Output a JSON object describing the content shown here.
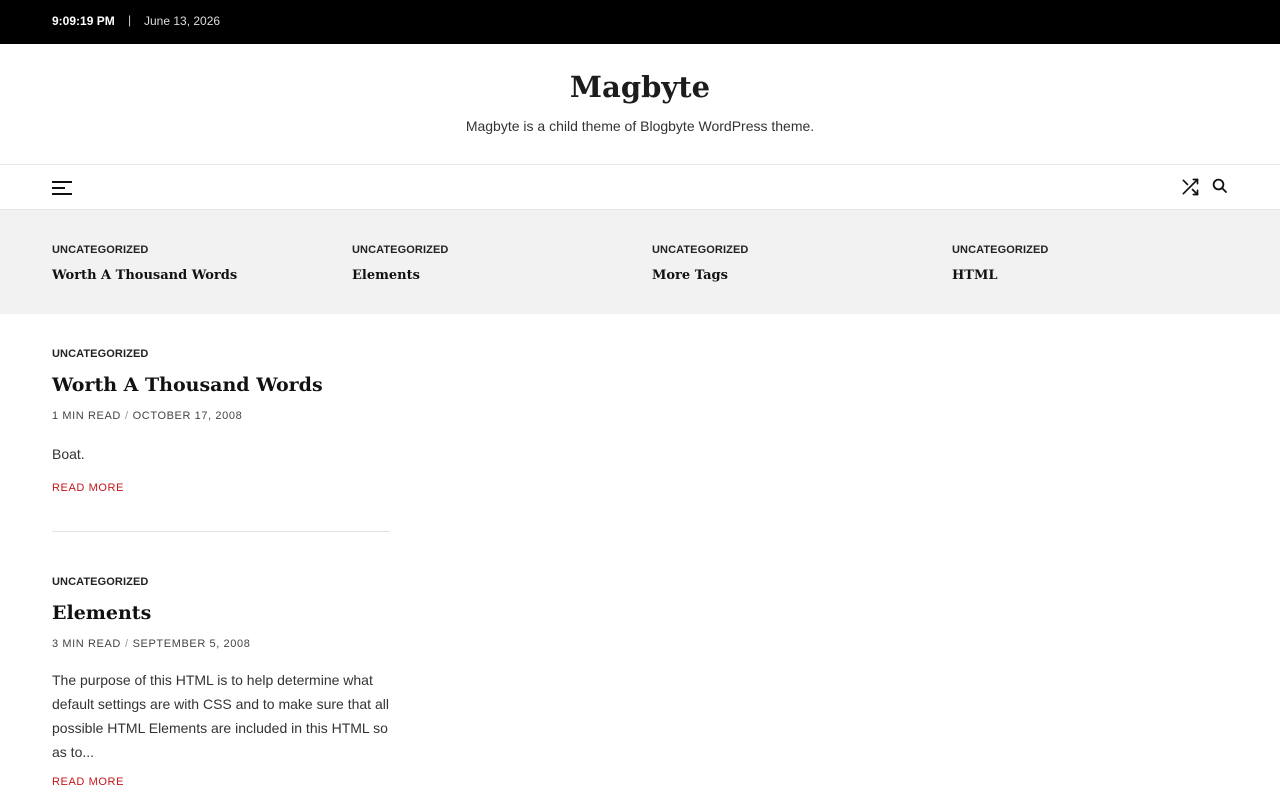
{
  "topbar": {
    "time": "9:09:19 PM",
    "separator": "|",
    "date": "June 13, 2026"
  },
  "site": {
    "title": "Magbyte",
    "description": "Magbyte is a child theme of Blogbyte WordPress theme."
  },
  "nav": {
    "menu_icon": "hamburger-icon",
    "shuffle_icon": "shuffle-icon",
    "search_icon": "search-icon"
  },
  "featured": [
    {
      "category": "UNCATEGORIZED",
      "title": "Worth A Thousand Words"
    },
    {
      "category": "UNCATEGORIZED",
      "title": "Elements"
    },
    {
      "category": "UNCATEGORIZED",
      "title": "More Tags"
    },
    {
      "category": "UNCATEGORIZED",
      "title": "HTML"
    }
  ],
  "posts": [
    {
      "category": "UNCATEGORIZED",
      "title": "Worth A Thousand Words",
      "read_time": "1 MIN READ",
      "meta_sep": "/",
      "date": "OCTOBER 17, 2008",
      "excerpt": "Boat.",
      "read_more": "READ MORE"
    },
    {
      "category": "UNCATEGORIZED",
      "title": "Elements",
      "read_time": "3 MIN READ",
      "meta_sep": "/",
      "date": "SEPTEMBER 5, 2008",
      "excerpt": "The purpose of this HTML is to help determine what default settings are with CSS and to make sure that all possible HTML Elements are included in this HTML so as to...",
      "read_more": "READ MORE"
    }
  ],
  "colors": {
    "topbar_bg": "#000000",
    "featured_bg": "#f2f2f2",
    "read_more": "#c4161c",
    "text": "#1a1a1a"
  }
}
